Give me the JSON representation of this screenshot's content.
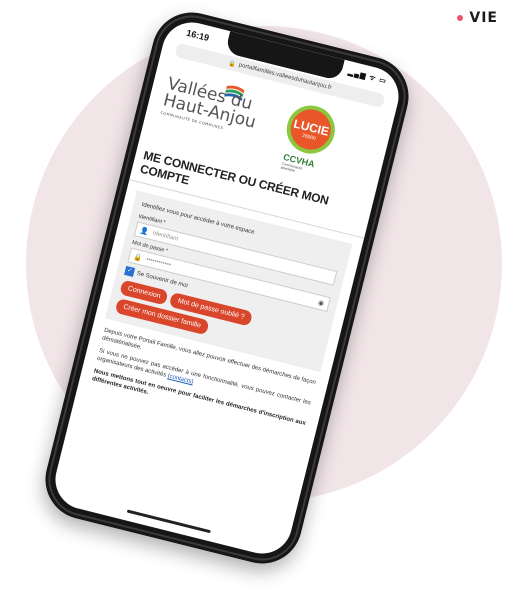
{
  "corner_tag": "VIE",
  "colors": {
    "circle_bg": "#f2e5e8",
    "accent_button": "#d9462b",
    "tag_dot": "#e8566a",
    "lucie_orange": "#e8562a",
    "ccvha_green": "#2e7d32"
  },
  "status": {
    "time": "16:19",
    "icons": "▂▄▆ ᯤ ▭"
  },
  "browser": {
    "url": "portailfamilles.valleesduhautanjou.fr"
  },
  "logo": {
    "line1": "Vallées du",
    "line2": "Haut-Anjou",
    "line3": "COMMUNAUTÉ DE COMMUNES"
  },
  "lucie": {
    "name": "LUCIE",
    "sub": "26000"
  },
  "ccvha": {
    "name": "CCVHA",
    "sub1": "Communauté",
    "sub2": "labellisée"
  },
  "page_title": "ME CONNECTER OU CRÉER MON COMPTE",
  "form": {
    "intro": "Identifiez vous pour accéder à votre espace",
    "id_label": "Identifiant *",
    "id_placeholder": "Identifiant",
    "pw_label": "Mot de passe *",
    "pw_value": "••••••••••••",
    "remember": "Se Souvenir de moi",
    "btn_login": "Connexion",
    "btn_forgot": "Mot de passe oublié ?",
    "btn_create": "Créer mon dossier famille"
  },
  "info": {
    "p1": "Depuis votre Portail Famille, vous allez pouvoir effectuer des démarches de façon dématérialisée.",
    "p2": "Si vous ne pouvez pas accéder à une fonctionnalité, vous pouvez contacter les organisateurs des activités",
    "p2_link": "(contacts)",
    "p3": "Nous mettons tout en oeuvre pour faciliter les démarches d'inscription aux différentes activités."
  }
}
